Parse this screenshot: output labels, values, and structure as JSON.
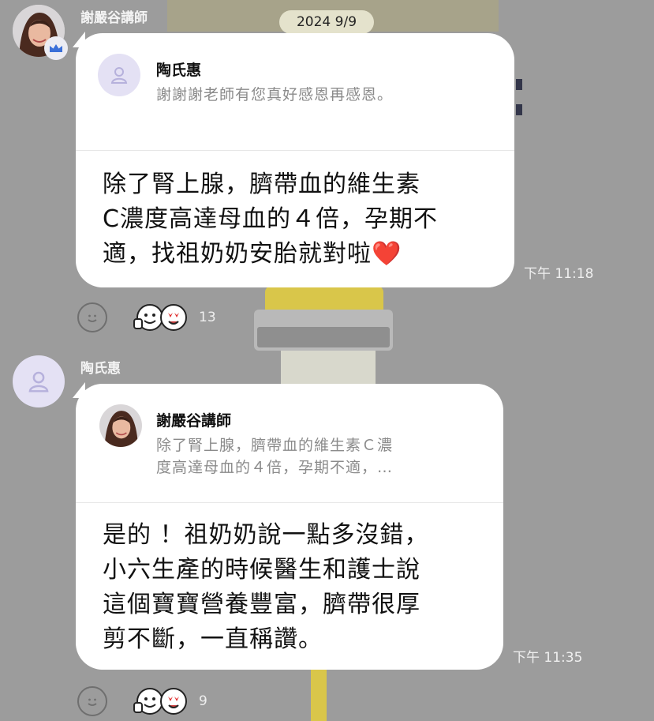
{
  "date_separator": "2024 9/9",
  "messages": [
    {
      "sender": "謝嚴谷講師",
      "quote": {
        "name": "陶氏惠",
        "text_lines": [
          "謝謝謝老師有您真好感恩再感恩。"
        ]
      },
      "text_lines": [
        "除了腎上腺，臍帶血的維生素",
        "C濃度高達母血的４倍，孕期不",
        "適，找祖奶奶安胎就對啦"
      ],
      "emoji": "❤️",
      "time": "下午 11:18",
      "reaction_count": "13"
    },
    {
      "sender": "陶氏惠",
      "quote": {
        "name": "謝嚴谷講師",
        "text_lines": [
          "除了腎上腺，臍帶血的維生素Ｃ濃",
          "度高達母血的４倍，孕期不適，…"
        ]
      },
      "text_lines": [
        "是的 ！祖奶奶說一點多沒錯，",
        "小六生產的時候醫生和護士說",
        "這個寶寶營養豐富，臍帶很厚",
        "剪不斷，一直稱讚。"
      ],
      "time": "下午 11:35",
      "reaction_count": "9"
    }
  ],
  "colors": {
    "background": "#9c9c9c",
    "bubble": "#ffffff",
    "date_pill": "#e4e2cc",
    "default_avatar": "#e4e1f4",
    "crown_badge": "#3a6fd8"
  },
  "icons": [
    "crown-icon",
    "person-icon",
    "smiley-icon",
    "thumbs-up-face-icon",
    "heart-eyes-face-icon"
  ]
}
